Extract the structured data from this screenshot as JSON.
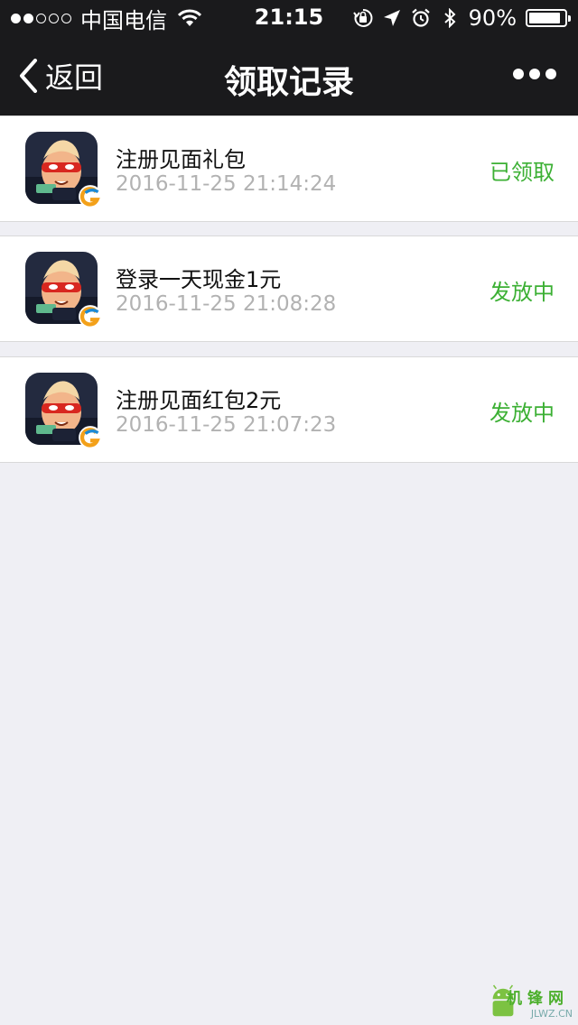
{
  "status_bar": {
    "carrier": "中国电信",
    "time": "21:15",
    "battery": "90%",
    "battery_level": 0.9,
    "signal_strength": 2
  },
  "nav": {
    "back_label": "返回",
    "title": "领取记录"
  },
  "records": [
    {
      "title": "注册见面礼包",
      "time": "2016-11-25 21:14:24",
      "status": "已领取"
    },
    {
      "title": "登录一天现金1元",
      "time": "2016-11-25 21:08:28",
      "status": "发放中"
    },
    {
      "title": "注册见面红包2元",
      "time": "2016-11-25 21:07:23",
      "status": "发放中"
    }
  ],
  "watermark": {
    "text": "机锋网",
    "sub": "JLWZ.CN"
  },
  "colors": {
    "status": "#3cb034",
    "nav_bg": "#1a1a1c",
    "page_bg": "#efeff4"
  }
}
